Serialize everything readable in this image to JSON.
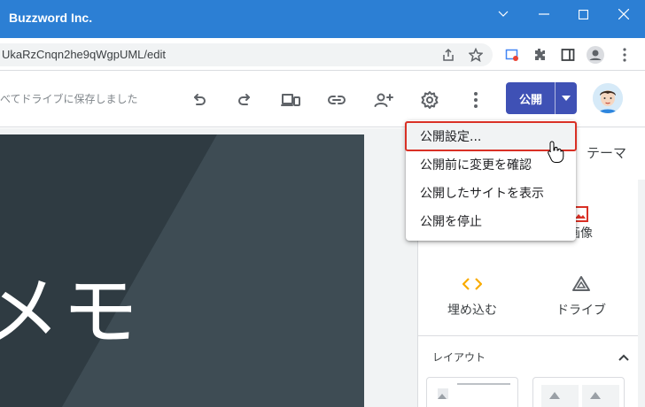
{
  "window": {
    "title": "Buzzword Inc."
  },
  "address_bar": {
    "url": "UkaRzCnqn2he9qWgpUML/edit"
  },
  "toolbar": {
    "saved_status": "べてドライブに保存しました",
    "publish_label": "公開"
  },
  "canvas": {
    "header_text": "メモ"
  },
  "panel": {
    "theme_tab": "テーマ",
    "insert_items": [
      {
        "label": "画像",
        "icon": "image-icon"
      },
      {
        "label": "埋め込む",
        "icon": "embed-icon"
      },
      {
        "label": "ドライブ",
        "icon": "drive-icon"
      }
    ],
    "layout_title": "レイアウト"
  },
  "publish_menu": {
    "items": [
      {
        "label": "公開設定..."
      },
      {
        "label": "公開前に変更を確認"
      },
      {
        "label": "公開したサイトを表示"
      },
      {
        "label": "公開を停止"
      }
    ]
  },
  "colors": {
    "title_bar": "#2c7fd4",
    "publish_button": "#3f51b5",
    "highlight_outline": "#d93025",
    "embed_icon": "#f9ab00",
    "image_icon": "#d93025"
  }
}
